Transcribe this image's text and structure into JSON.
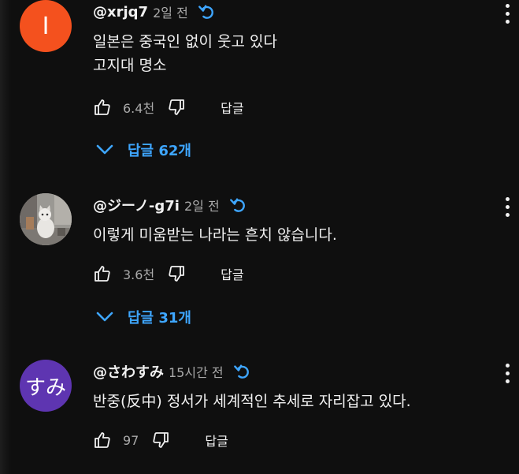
{
  "comments": [
    {
      "avatar_text": "I",
      "avatar_color": "#f4511e",
      "author": "@xrjq7",
      "time": "2일 전",
      "lines": [
        "일본은 중국인 없이 웃고 있다",
        "고지대 명소"
      ],
      "likes": "6.4천",
      "reply_label": "답글",
      "replies_toggle": "답글 62개",
      "icons": [
        "edited-refresh-icon",
        "like-icon",
        "dislike-icon",
        "more-vert-icon",
        "chevron-down-icon"
      ]
    },
    {
      "avatar_text": "",
      "avatar_color": "#8a8a86",
      "author": "@ジーノ-g7i",
      "time": "2일 전",
      "lines": [
        "이렇게 미움받는 나라는 흔치 않습니다."
      ],
      "likes": "3.6천",
      "reply_label": "답글",
      "replies_toggle": "답글 31개"
    },
    {
      "avatar_text": "すみ",
      "avatar_color": "#5e35b1",
      "author": "@さわすみ",
      "time": "15시간 전",
      "lines": [
        "반중(反中) 정서가 세계적인 추세로 자리잡고 있다."
      ],
      "likes": "97",
      "reply_label": "답글"
    }
  ],
  "colors": {
    "background": "#0f0f0f",
    "text": "#f1f1f1",
    "muted": "#aaaaaa",
    "accent": "#3ea6ff"
  }
}
